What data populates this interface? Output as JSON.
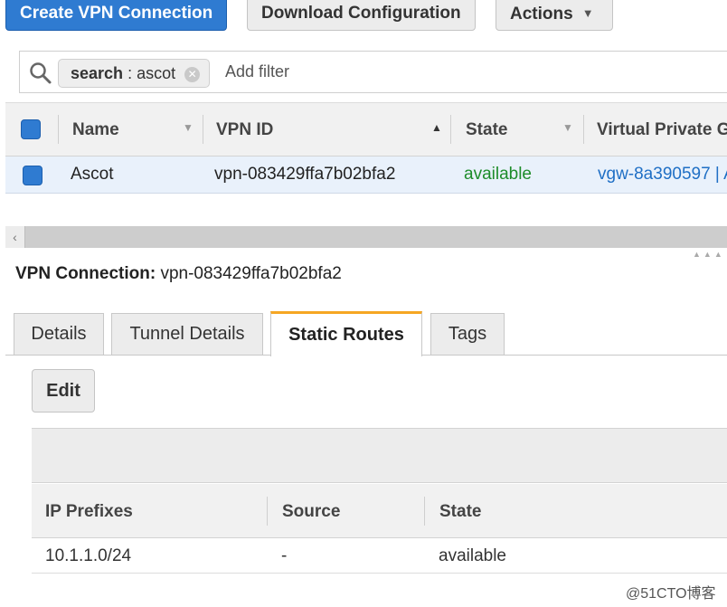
{
  "toolbar": {
    "create_label": "Create VPN Connection",
    "download_label": "Download Configuration",
    "actions_label": "Actions"
  },
  "filter": {
    "chip_key": "search",
    "chip_sep": ":",
    "chip_value": "ascot",
    "placeholder": "Add filter"
  },
  "grid": {
    "columns": [
      "Name",
      "VPN ID",
      "State",
      "Virtual Private G"
    ],
    "rows": [
      {
        "name": "Ascot",
        "vpn_id": "vpn-083429ffa7b02bfa2",
        "state": "available",
        "vgw": "vgw-8a390597 | A"
      }
    ]
  },
  "detail": {
    "label": "VPN Connection:",
    "vpn_id": "vpn-083429ffa7b02bfa2",
    "tabs": [
      "Details",
      "Tunnel Details",
      "Static Routes",
      "Tags"
    ],
    "active_tab": "Static Routes",
    "edit_label": "Edit",
    "routes": {
      "columns": [
        "IP Prefixes",
        "Source",
        "State"
      ],
      "rows": [
        {
          "prefix": "10.1.1.0/24",
          "source": "-",
          "state": "available"
        }
      ]
    }
  },
  "watermark": "@51CTO博客",
  "colors": {
    "primary": "#2f7bd1",
    "available": "#1d8c2a",
    "link": "#1f6fc5",
    "active_tab_accent": "#f5a623"
  }
}
